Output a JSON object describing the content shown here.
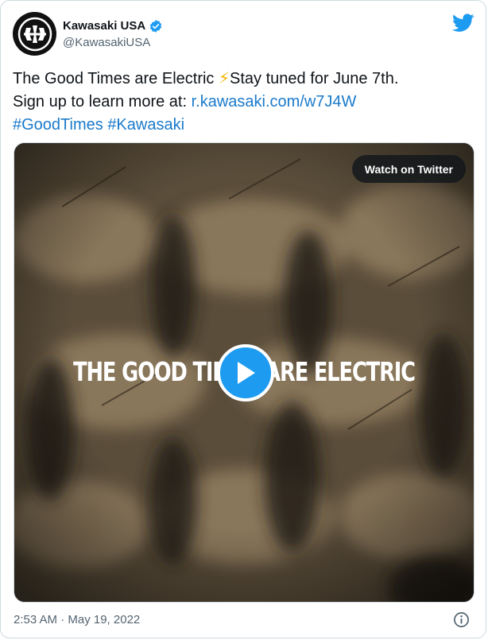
{
  "author": {
    "display_name": "Kawasaki USA",
    "handle": "@KawasakiUSA",
    "verified_icon": "verified-badge-icon",
    "avatar_icon": "kawasaki-logo-icon"
  },
  "brand_icon": "twitter-bird-icon",
  "tweet": {
    "text_part1": "The Good Times are Electric ",
    "emoji": "⚡",
    "text_part2": "Stay tuned for June 7th.",
    "text_part3": "Sign up to learn more at: ",
    "link": "r.kawasaki.com/w7J4W",
    "hashtag1": "#GoodTimes",
    "hashtag2": "#Kawasaki"
  },
  "media": {
    "overlay_text": "THE GOOD TIMES ARE ELECTRIC",
    "watch_label": "Watch on Twitter",
    "play_icon": "play-icon"
  },
  "footer": {
    "timestamp": "2:53 AM · May 19, 2022",
    "info_icon": "info-icon"
  },
  "colors": {
    "link": "#1b7acb",
    "accent": "#1d9bf0",
    "muted": "#536471"
  }
}
